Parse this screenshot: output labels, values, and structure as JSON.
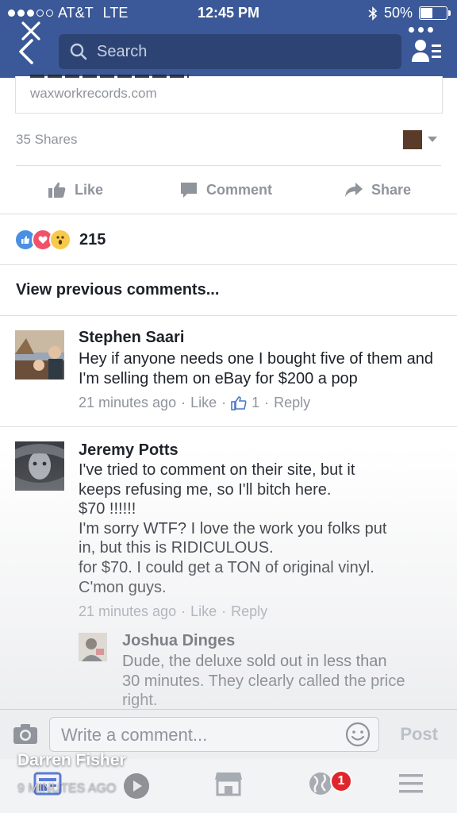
{
  "status_bar": {
    "carrier": "AT&T",
    "network": "LTE",
    "time": "12:45 PM",
    "battery": "50%",
    "battery_level": 0.5
  },
  "nav": {
    "search_placeholder": "Search"
  },
  "link_preview": {
    "domain": "waxworkrecords.com"
  },
  "post": {
    "shares": "35 Shares",
    "actions": {
      "like": "Like",
      "comment": "Comment",
      "share": "Share"
    },
    "reactions_count": "215",
    "view_previous": "View previous comments..."
  },
  "comments": [
    {
      "name": "Stephen Saari",
      "text": "Hey if anyone needs one I bought five of them and I'm selling them on eBay for $200 a pop",
      "time": "21 minutes ago",
      "like": "Like",
      "likes_count": "1",
      "reply": "Reply"
    },
    {
      "name": "Jeremy Potts",
      "text": "I've tried to comment on their site, but it\nkeeps refusing me, so I'll bitch here.\n$70 !!!!!!\nI'm sorry WTF? I love the work you folks put\nin, but this is RIDICULOUS.\nfor $70. I could get a TON of original vinyl.\nC'mon guys.",
      "time": "21 minutes ago",
      "like": "Like",
      "reply": "Reply"
    },
    {
      "name": "Joshua Dinges",
      "text": "Dude, the deluxe sold out in less than\n30 minutes. They clearly called the price\nright."
    }
  ],
  "composer": {
    "placeholder": "Write a comment...",
    "post_label": "Post"
  },
  "tabbar": {
    "notifications_badge": "1"
  },
  "story_overlay": {
    "name": "Darren Fisher",
    "time": "9 MINUTES AGO"
  },
  "colors": {
    "brand": "#3b5998",
    "meta_gray": "#90949c",
    "badge_red": "#e0262c"
  }
}
